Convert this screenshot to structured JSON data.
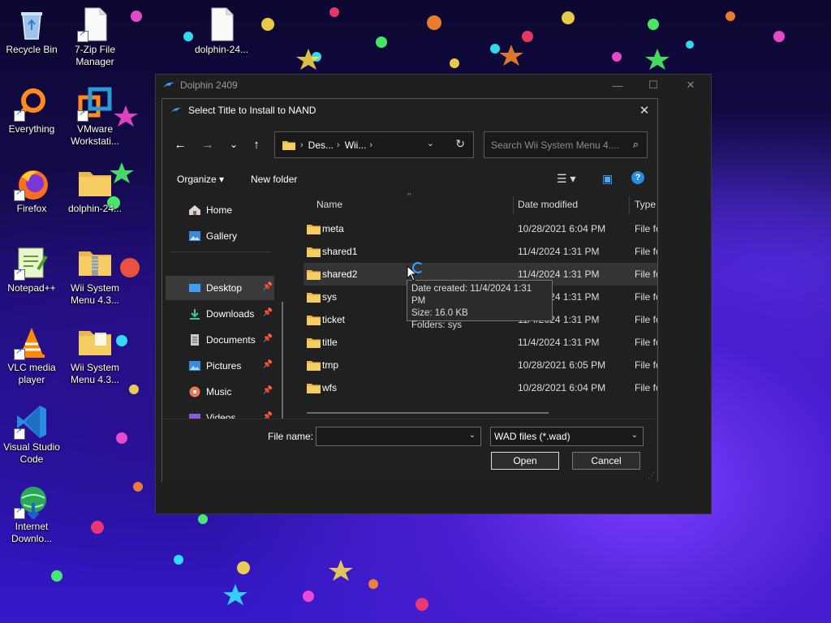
{
  "desktop": {
    "icons": [
      {
        "label": "Recycle Bin"
      },
      {
        "label": "7-Zip File Manager"
      },
      {
        "label": "dolphin-24..."
      },
      {
        "label": "Everything"
      },
      {
        "label": "VMware Workstati..."
      },
      {
        "label": "Firefox"
      },
      {
        "label": "dolphin-24..."
      },
      {
        "label": "Notepad++"
      },
      {
        "label": "Wii System Menu 4.3..."
      },
      {
        "label": "VLC media player"
      },
      {
        "label": "Wii System Menu 4.3..."
      },
      {
        "label": "Visual Studio Code"
      },
      {
        "label": "Internet Downlo..."
      }
    ]
  },
  "dolphin_window": {
    "title": "Dolphin 2409",
    "minimize": "—",
    "maximize": "☐",
    "close": "✕"
  },
  "dialog": {
    "title": "Select Title to Install to NAND",
    "close": "✕",
    "nav": {
      "back": "←",
      "forward": "→",
      "recent": "⌄",
      "up": "↑"
    },
    "address": {
      "crumbs": [
        "Des...",
        "Wii..."
      ],
      "separator": "›",
      "dropdown": "⌄",
      "refresh": "↻"
    },
    "search": {
      "placeholder": "Search Wii System Menu 4....",
      "icon": "⌕"
    },
    "toolbar": {
      "organize": "Organize ▾",
      "new_folder": "New folder",
      "view_icon": "☰ ▾",
      "preview_icon": "▣",
      "help_icon": "?"
    },
    "nav_pane": [
      {
        "label": "Home",
        "icon": "home-icon",
        "pinned": false
      },
      {
        "label": "Gallery",
        "icon": "gallery-icon",
        "pinned": false
      },
      {
        "label": "Desktop",
        "icon": "desktop-icon",
        "pinned": true,
        "selected": true
      },
      {
        "label": "Downloads",
        "icon": "downloads-icon",
        "pinned": true
      },
      {
        "label": "Documents",
        "icon": "documents-icon",
        "pinned": true
      },
      {
        "label": "Pictures",
        "icon": "pictures-icon",
        "pinned": true
      },
      {
        "label": "Music",
        "icon": "music-icon",
        "pinned": true
      },
      {
        "label": "Videos",
        "icon": "videos-icon",
        "pinned": true
      }
    ],
    "pin_glyph": "📌",
    "columns": {
      "name": "Name",
      "date": "Date modified",
      "type": "Type",
      "sort": "^"
    },
    "files": [
      {
        "name": "meta",
        "date": "10/28/2021 6:04 PM",
        "type": "File fo"
      },
      {
        "name": "shared1",
        "date": "11/4/2024 1:31 PM",
        "type": "File fo"
      },
      {
        "name": "shared2",
        "date": "11/4/2024 1:31 PM",
        "type": "File fo"
      },
      {
        "name": "sys",
        "date": "11/4/2024 1:31 PM",
        "type": "File fo"
      },
      {
        "name": "ticket",
        "date": "11/4/2024 1:31 PM",
        "type": "File fo"
      },
      {
        "name": "title",
        "date": "11/4/2024 1:31 PM",
        "type": "File fo"
      },
      {
        "name": "tmp",
        "date": "10/28/2021 6:05 PM",
        "type": "File fo"
      },
      {
        "name": "wfs",
        "date": "10/28/2021 6:04 PM",
        "type": "File fo"
      }
    ],
    "tooltip": {
      "created": "Date created: 11/4/2024 1:31 PM",
      "size": "Size: 16.0 KB",
      "folders": "Folders: sys"
    },
    "bottom": {
      "file_name_label": "File name:",
      "file_name_value": "",
      "filter": "WAD files (*.wad)",
      "dropdown": "⌄",
      "open": "Open",
      "cancel": "Cancel",
      "grip": "⋰"
    }
  },
  "colors": {
    "folder": "#e8b84a",
    "accent_blue": "#3aa0ff"
  }
}
